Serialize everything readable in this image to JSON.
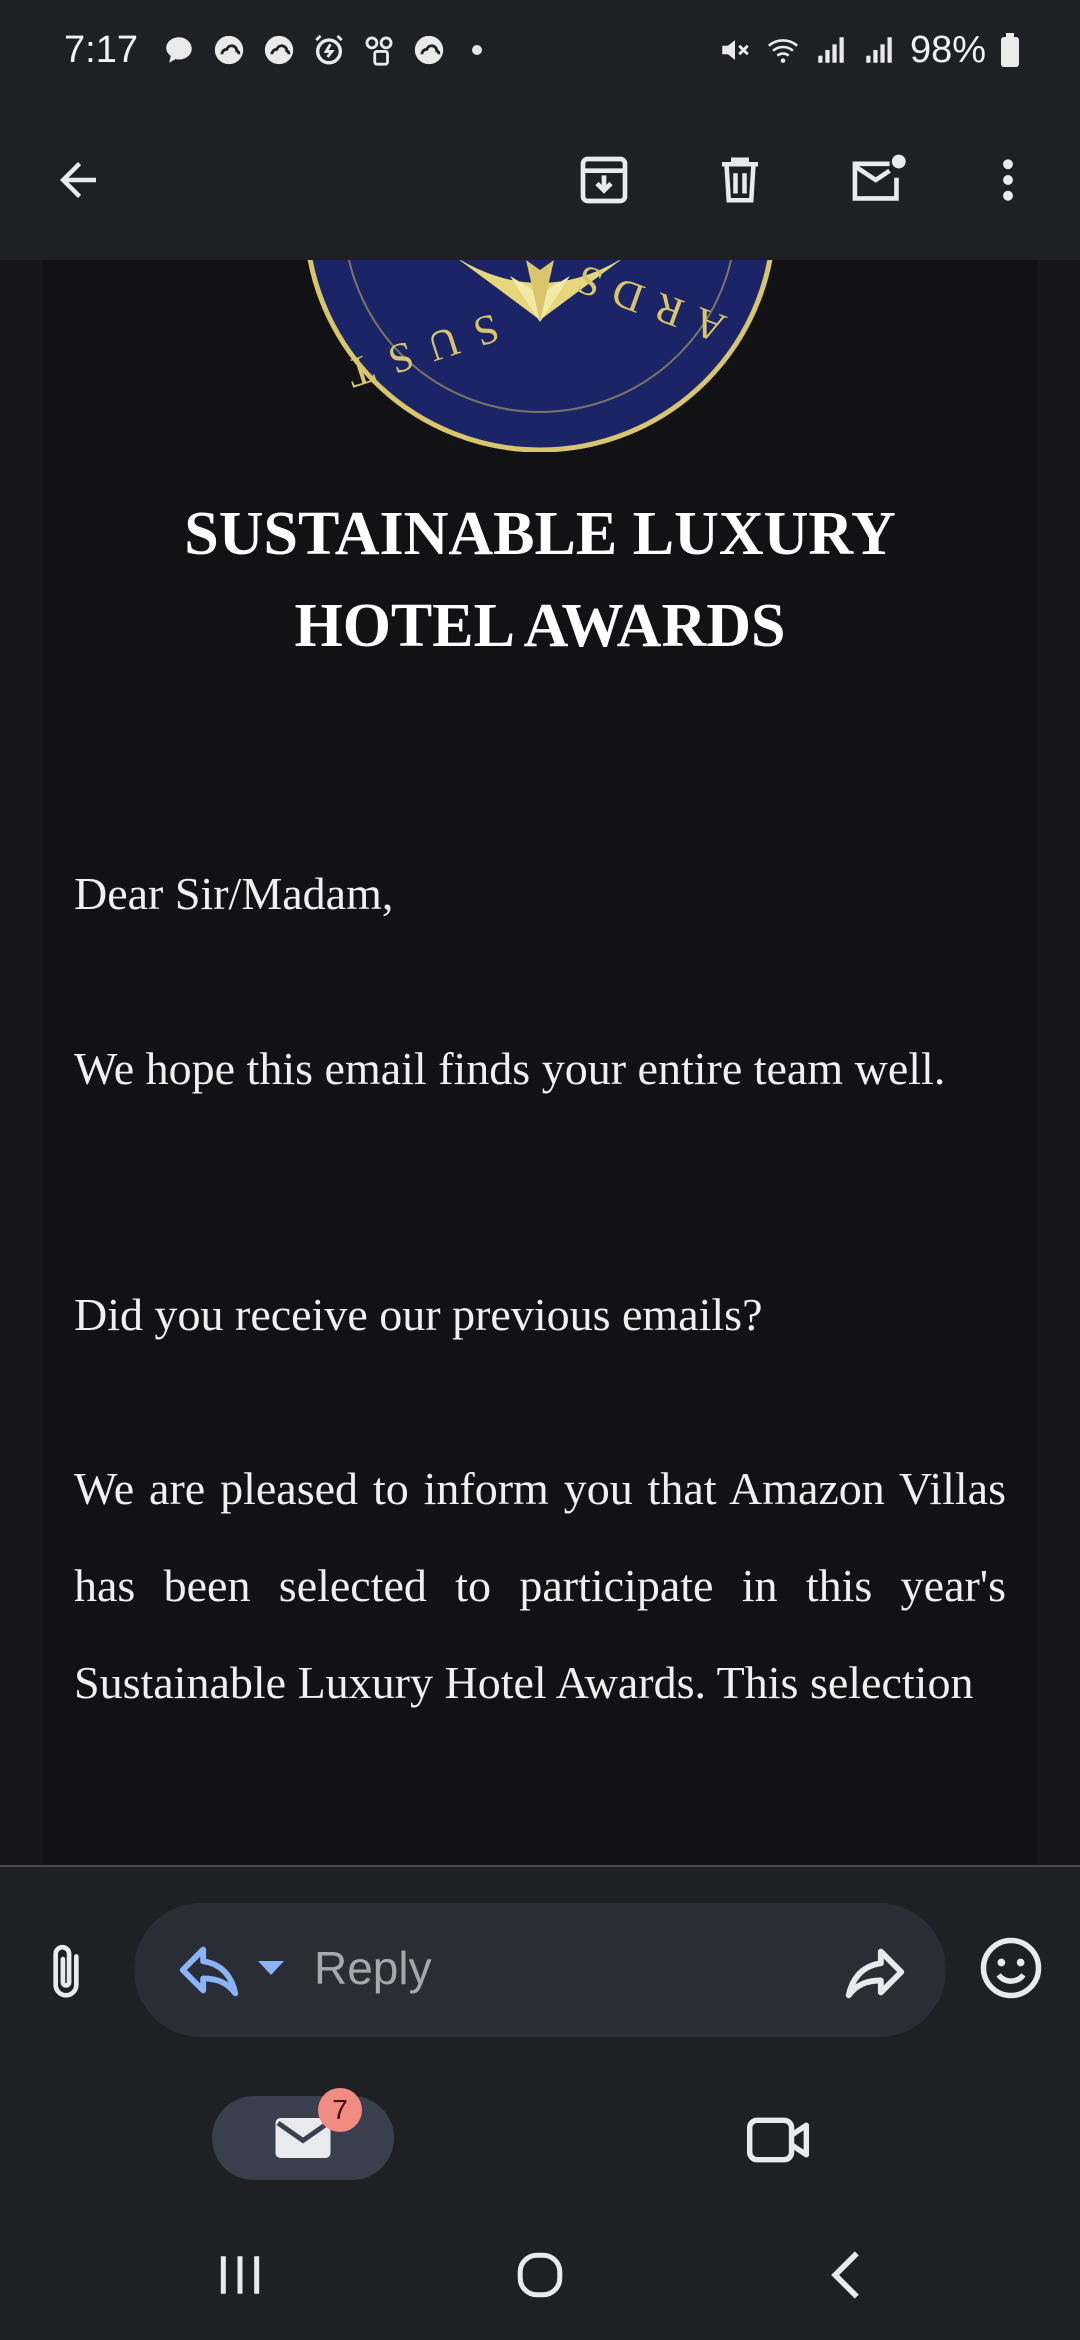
{
  "status_bar": {
    "time": "7:17",
    "battery": "98%",
    "notification_icons": [
      "chat-bubble-icon",
      "cloud-icon",
      "cloud-icon",
      "alarm-icon",
      "voicemail-icon",
      "cloud-icon"
    ]
  },
  "app_bar": {
    "actions": [
      "back",
      "archive",
      "delete",
      "mark-unread",
      "more-options"
    ]
  },
  "email": {
    "seal_text_left": "SUST",
    "seal_text_right": "ARDS",
    "headline_line1": "SUSTAINABLE LUXURY",
    "headline_line2": "HOTEL AWARDS",
    "greeting": "Dear Sir/Madam,",
    "paragraph1": "We hope this email finds your entire team well.",
    "paragraph2": "Did you receive our previous emails?",
    "paragraph3": "We are pleased to inform you that Amazon Villas has been selected to participate in this year's Sustainable Luxury Hotel Awards. This selection"
  },
  "reply_bar": {
    "reply_label": "Reply"
  },
  "bottom_nav": {
    "mail_badge": "7"
  },
  "colors": {
    "background": "#1f2024",
    "email_background": "#121214",
    "accent": "#8ab4f8",
    "badge": "#f28b82",
    "seal_navy": "#1a2466",
    "seal_gold": "#d9c56b"
  }
}
